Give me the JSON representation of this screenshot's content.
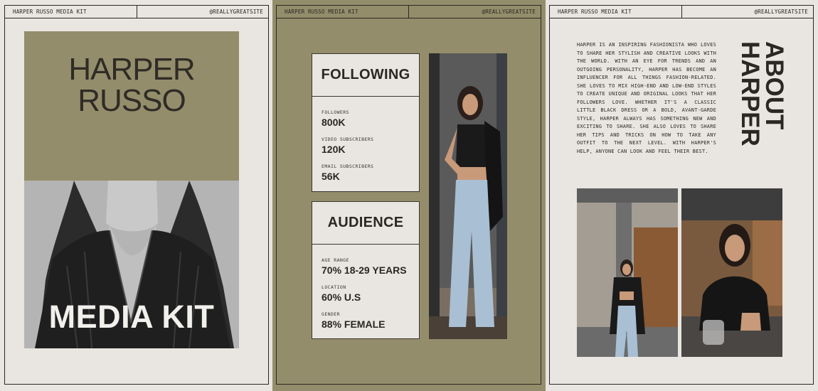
{
  "header": {
    "left_label": "HARPER RUSSO MEDIA KIT",
    "right_label": "@REALLYGREATSITE"
  },
  "cover": {
    "name_line1": "HARPER",
    "name_line2": "RUSSO",
    "title": "MEDIA KIT"
  },
  "following": {
    "title": "FOLLOWING",
    "stats": [
      {
        "label": "FOLLOWERS",
        "value": "800K"
      },
      {
        "label": "VIDEO SUBSCRIBERS",
        "value": "120K"
      },
      {
        "label": "EMAIL SUBSCRIBERS",
        "value": "56K"
      }
    ]
  },
  "audience": {
    "title": "AUDIENCE",
    "stats": [
      {
        "label": "AGE RANGE",
        "value": "70% 18-29 YEARS"
      },
      {
        "label": "LOCATION",
        "value": "60% U.S"
      },
      {
        "label": "GENDER",
        "value": "88% FEMALE"
      }
    ]
  },
  "about": {
    "heading_line1": "ABOUT",
    "heading_line2": "HARPER",
    "bio": "HARPER IS AN INSPIRING FASHIONISTA WHO LOVES TO SHARE HER STYLISH AND CREATIVE LOOKS WITH THE WORLD. WITH AN EYE FOR TRENDS AND AN OUTGOING PERSONALITY, HARPER HAS BECOME AN INFLUENCER FOR ALL THINGS FASHION-RELATED. SHE LOVES TO MIX HIGH-END AND LOW-END STYLES TO CREATE UNIQUE AND ORIGINAL LOOKS THAT HER FOLLOWERS LOVE. WHETHER IT'S A CLASSIC LITTLE BLACK DRESS OR A BOLD, AVANT-GARDE STYLE, HARPER ALWAYS HAS SOMETHING NEW AND EXCITING TO SHARE. SHE ALSO LOVES TO SHARE HER TIPS AND TRICKS ON HOW TO TAKE ANY OUTFIT TO THE NEXT LEVEL. WITH HARPER'S HELP, ANYONE CAN LOOK AND FEEL THEIR BEST."
  },
  "colors": {
    "olive": "#948d6b",
    "paper": "#e9e5e0",
    "ink": "#2a2724"
  }
}
